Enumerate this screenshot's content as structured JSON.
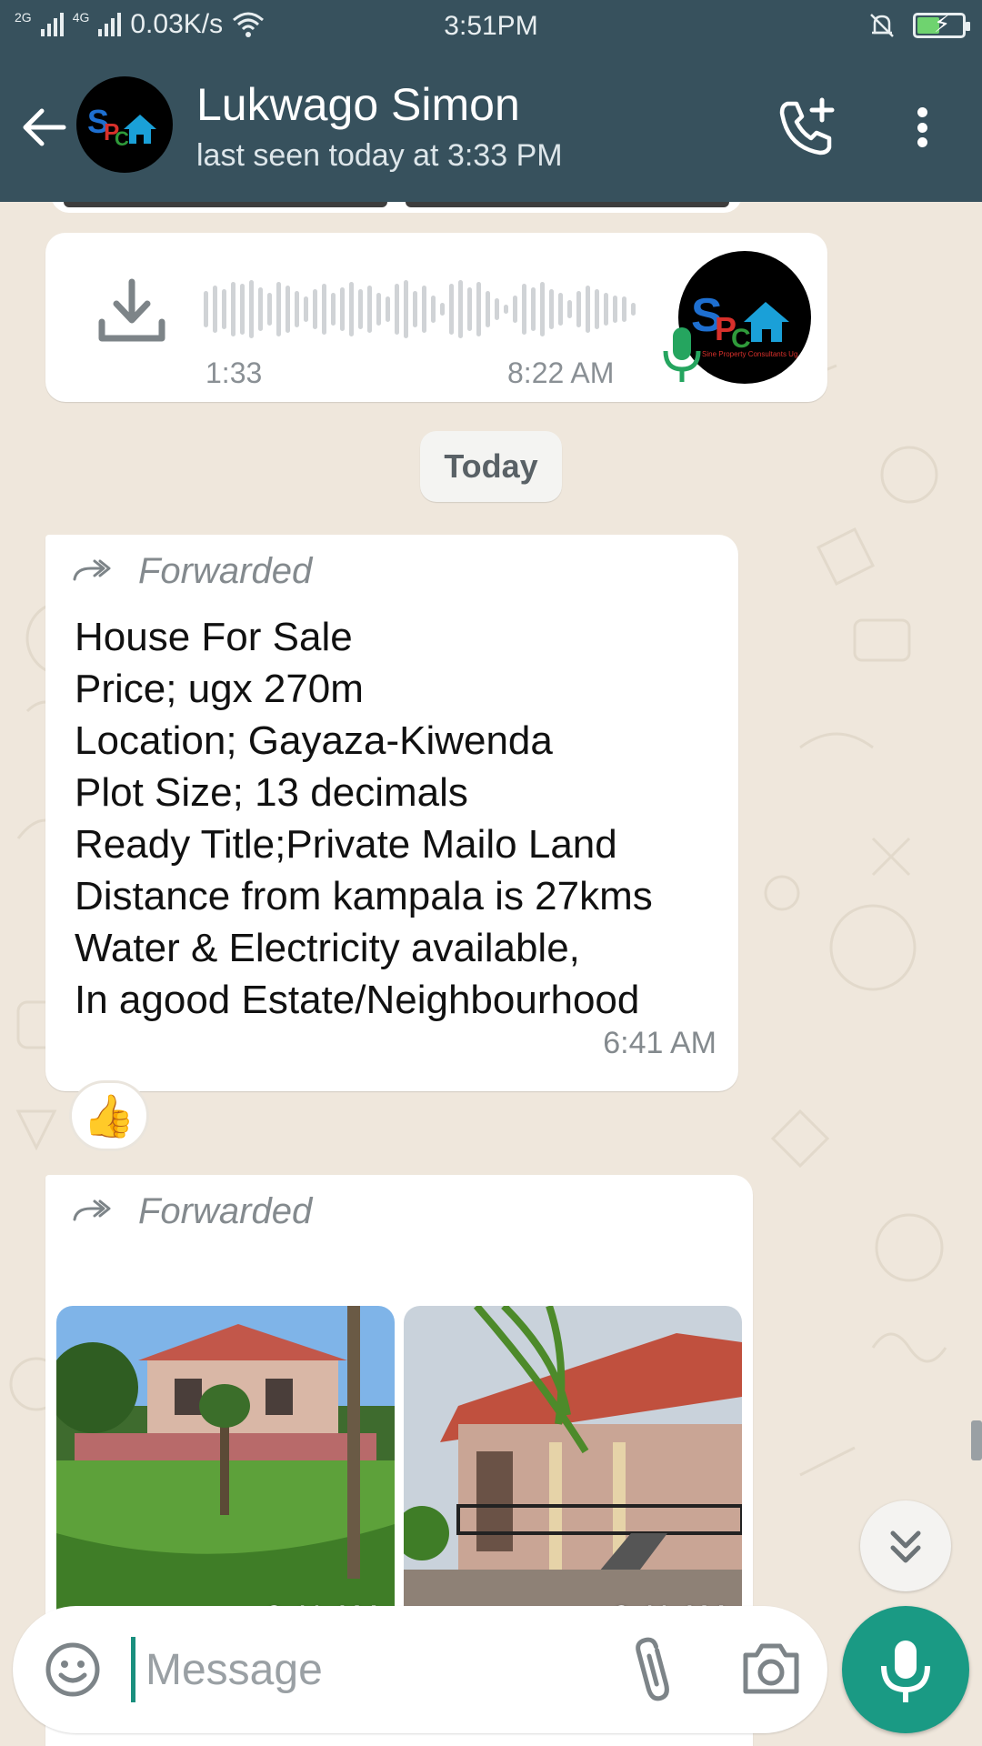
{
  "status_bar": {
    "net_left": "2G",
    "net_right": "4G",
    "speed": "0.03K/s",
    "time": "3:51PM",
    "icons": [
      "signal-icon",
      "wifi-icon",
      "mute-bell-icon",
      "battery-charging-icon"
    ]
  },
  "header": {
    "contact_name": "Lukwago Simon",
    "last_seen": "last seen today at 3:33 PM",
    "avatar_logo_text": "Sine Property Consultants Ug"
  },
  "voice_message": {
    "duration": "1:33",
    "time": "8:22 AM"
  },
  "date_divider": "Today",
  "text_message": {
    "forwarded_label": "Forwarded",
    "lines": [
      "House For Sale",
      "Price; ugx 270m",
      "Location; Gayaza-Kiwenda",
      "Plot Size; 13 decimals",
      "Ready Title;Private Mailo Land",
      "Distance from kampala is 27kms",
      "Water & Electricity available,",
      "In agood Estate/Neighbourhood"
    ],
    "time": "6:41 AM",
    "reaction": "👍"
  },
  "image_message": {
    "forwarded_label": "Forwarded",
    "photos": [
      {
        "time": "6:41 AM"
      },
      {
        "time": "6:41 AM"
      }
    ]
  },
  "composer": {
    "placeholder": "Message"
  },
  "colors": {
    "header": "#37515d",
    "chat_bg": "#efe7dc",
    "accent": "#1a9a84",
    "mic_green": "#25a55f"
  }
}
